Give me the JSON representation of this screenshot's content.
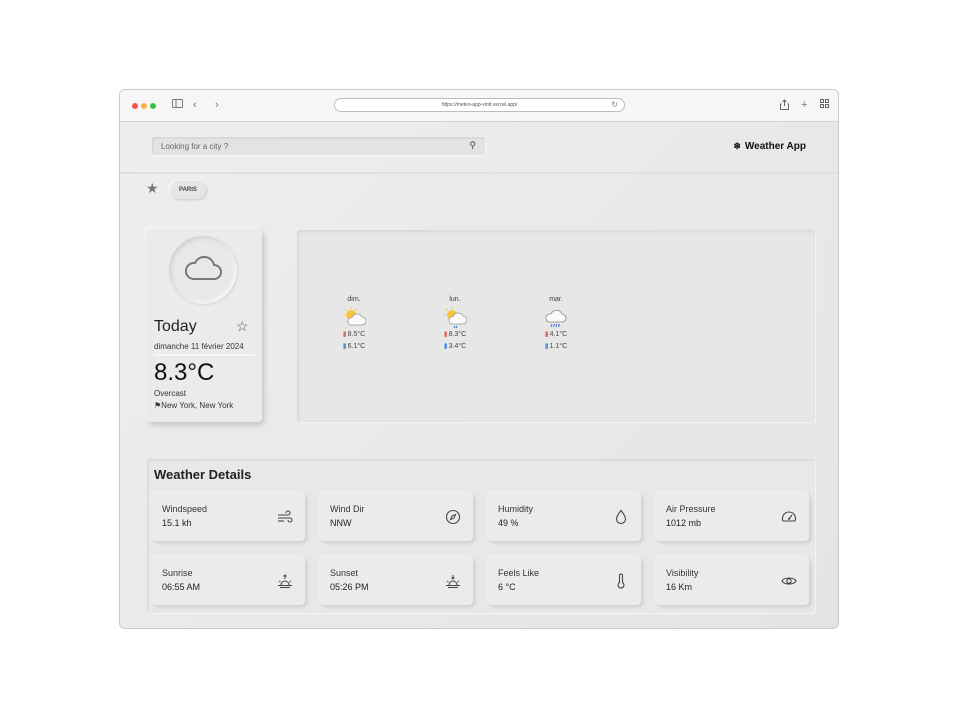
{
  "browser": {
    "url": "https://meteo-app-virid.vercel.app/"
  },
  "header": {
    "search_placeholder": "Looking for a city ?",
    "brand": "Weather App"
  },
  "favorites": {
    "chip": "PARIS"
  },
  "today": {
    "label": "Today",
    "date": "dimanche 11 février 2024",
    "temp": "8.3°C",
    "condition": "Overcast",
    "location": "New York, New York"
  },
  "forecast": [
    {
      "day": "dim.",
      "max": "8.5°C",
      "min": "6.1°C",
      "icon": "partly-cloudy-icon"
    },
    {
      "day": "lun.",
      "max": "8.3°C",
      "min": "3.4°C",
      "icon": "partly-cloudy-rain-icon"
    },
    {
      "day": "mar.",
      "max": "4.1°C",
      "min": "1.1°C",
      "icon": "rain-icon"
    }
  ],
  "details": {
    "title": "Weather Details",
    "cards": [
      {
        "label": "Windspeed",
        "value": "15.1 kh",
        "icon": "wind-icon"
      },
      {
        "label": "Wind Dir",
        "value": "NNW",
        "icon": "compass-icon"
      },
      {
        "label": "Humidity",
        "value": "49 %",
        "icon": "droplet-icon"
      },
      {
        "label": "Air Pressure",
        "value": "1012 mb",
        "icon": "gauge-icon"
      },
      {
        "label": "Sunrise",
        "value": "06:55 AM",
        "icon": "sunrise-icon"
      },
      {
        "label": "Sunset",
        "value": "05:26 PM",
        "icon": "sunset-icon"
      },
      {
        "label": "Feels Like",
        "value": "6 °C",
        "icon": "thermometer-icon"
      },
      {
        "label": "Visibility",
        "value": "16 Km",
        "icon": "eye-icon"
      }
    ]
  }
}
